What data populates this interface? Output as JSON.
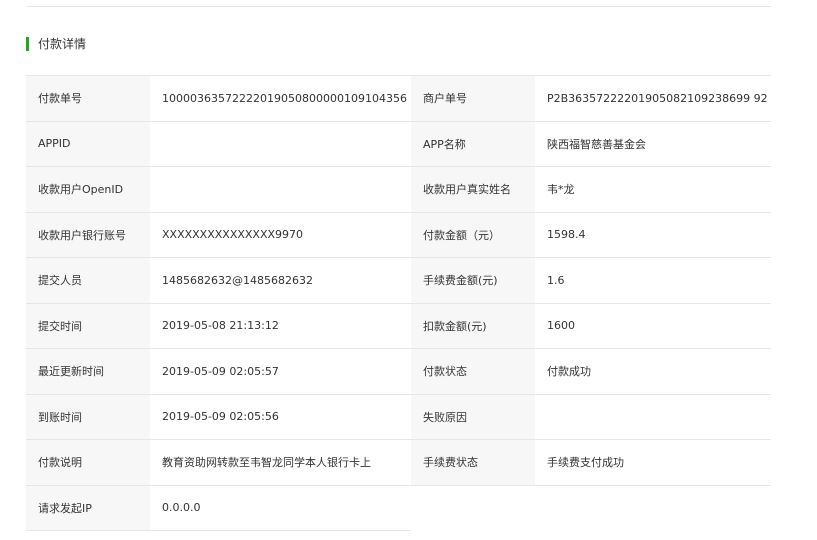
{
  "section": {
    "title": "付款详情"
  },
  "colors": {
    "accent": "#1aad19",
    "label_bg": "#f7f7f7",
    "border": "#e6e6e6"
  },
  "rows": [
    {
      "label1": "付款单号",
      "value1": "10000363572222019050800000109104356",
      "label2": "商户单号",
      "value2": "P2B36357222201905082109238699 92"
    },
    {
      "label1": "APPID",
      "value1": "",
      "label2": "APP名称",
      "value2": "陕西福智慈善基金会"
    },
    {
      "label1": "收款用户OpenID",
      "value1": "",
      "label2": "收款用户真实姓名",
      "value2": "韦*龙"
    },
    {
      "label1": "收款用户银行账号",
      "value1": "XXXXXXXXXXXXXXX9970",
      "label2": "付款金额（元）",
      "value2": "1598.4"
    },
    {
      "label1": "提交人员",
      "value1": "1485682632@1485682632",
      "label2": "手续费金额(元)",
      "value2": "1.6"
    },
    {
      "label1": "提交时间",
      "value1": "2019-05-08 21:13:12",
      "label2": "扣款金额(元)",
      "value2": "1600"
    },
    {
      "label1": "最近更新时间",
      "value1": "2019-05-09 02:05:57",
      "label2": "付款状态",
      "value2": "付款成功"
    },
    {
      "label1": "到账时间",
      "value1": "2019-05-09 02:05:56",
      "label2": "失败原因",
      "value2": ""
    },
    {
      "label1": "付款说明",
      "value1": "教育资助网转款至韦智龙同学本人银行卡上",
      "label2": "手续费状态",
      "value2": "手续费支付成功"
    },
    {
      "label1": "请求发起IP",
      "value1": "0.0.0.0"
    }
  ]
}
